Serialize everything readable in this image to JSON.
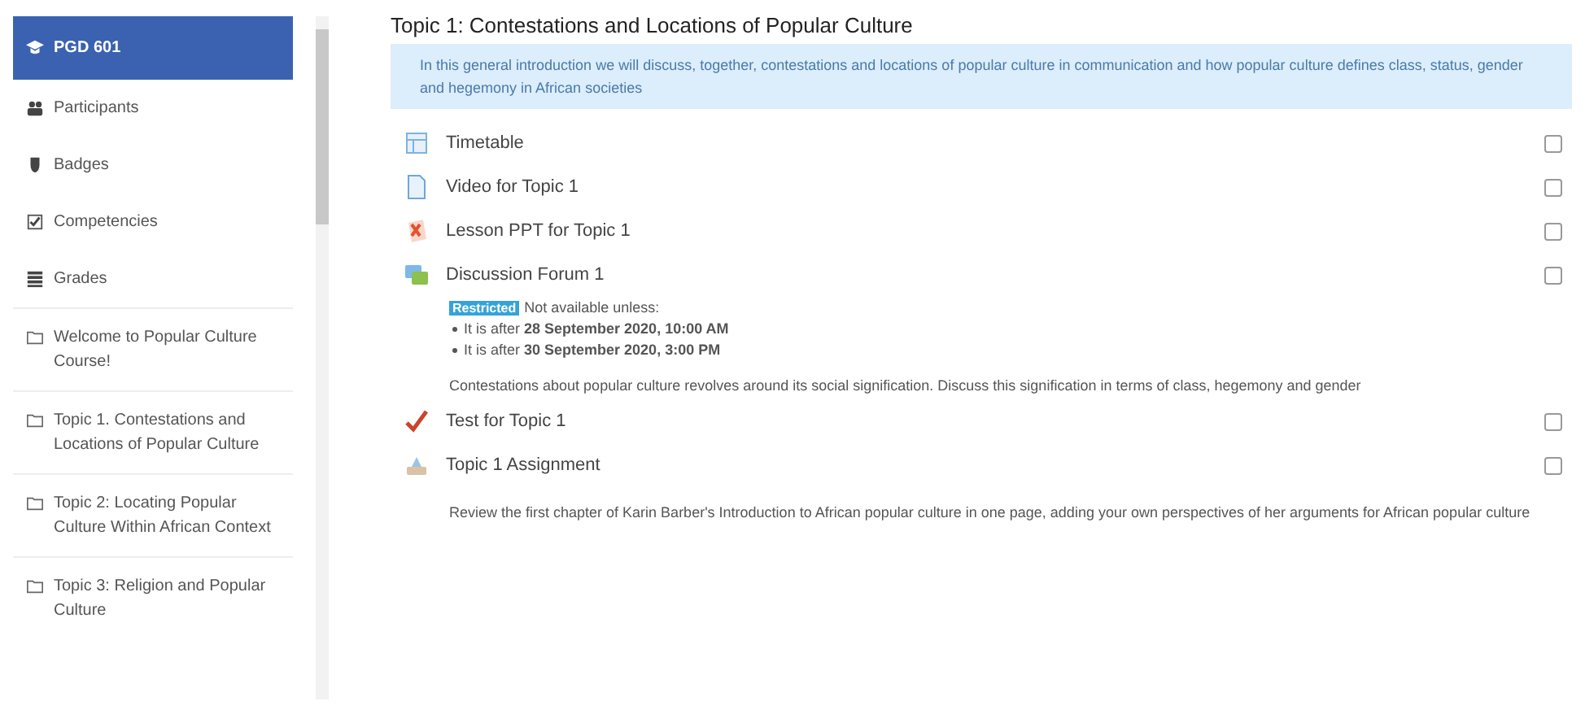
{
  "sidebar": {
    "items": [
      {
        "label": "PGD 601",
        "kind": "cap",
        "selected": true
      },
      {
        "label": "Participants",
        "kind": "users",
        "selected": false
      },
      {
        "label": "Badges",
        "kind": "shield",
        "selected": false
      },
      {
        "label": "Competencies",
        "kind": "checklist",
        "selected": false
      },
      {
        "label": "Grades",
        "kind": "table",
        "selected": false
      },
      {
        "label": "Welcome to Popular Culture Course!",
        "kind": "folder",
        "selected": false
      },
      {
        "label": "Topic 1. Contestations and Locations of Popular Culture",
        "kind": "folder",
        "selected": false
      },
      {
        "label": "Topic 2: Locating Popular Culture Within African Context",
        "kind": "folder",
        "selected": false
      },
      {
        "label": "Topic 3: Religion and Popular Culture",
        "kind": "folder",
        "selected": false
      }
    ]
  },
  "section": {
    "title": "Topic 1: Contestations and Locations of Popular Culture",
    "summary": "In this general introduction we will discuss, together, contestations and locations of popular culture in communication and how popular culture defines class, status, gender and hegemony in African societies",
    "activities": [
      {
        "kind": "page",
        "name": "Timetable",
        "completed": false
      },
      {
        "kind": "file",
        "name": "Video for Topic 1",
        "completed": false
      },
      {
        "kind": "ppt",
        "name": "Lesson PPT for Topic 1",
        "completed": false
      },
      {
        "kind": "forum",
        "name": "Discussion Forum 1",
        "completed": false,
        "restriction": {
          "badge": "Restricted",
          "intro": "Not available unless:",
          "conditions": [
            "It is after **28 September 2020, 10:00 AM**",
            "It is after **30 September 2020, 3:00 PM**"
          ]
        },
        "description": "Contestations about popular culture revolves around its social signification. Discuss this signification in terms of class, hegemony and gender"
      },
      {
        "kind": "quiz",
        "name": "Test for Topic 1",
        "completed": false
      },
      {
        "kind": "assign",
        "name": "Topic 1 Assignment",
        "completed": false,
        "description": "Review the first chapter of Karin Barber's Introduction to African popular culture in one page, adding your own perspectives of her arguments for African popular culture"
      }
    ]
  }
}
